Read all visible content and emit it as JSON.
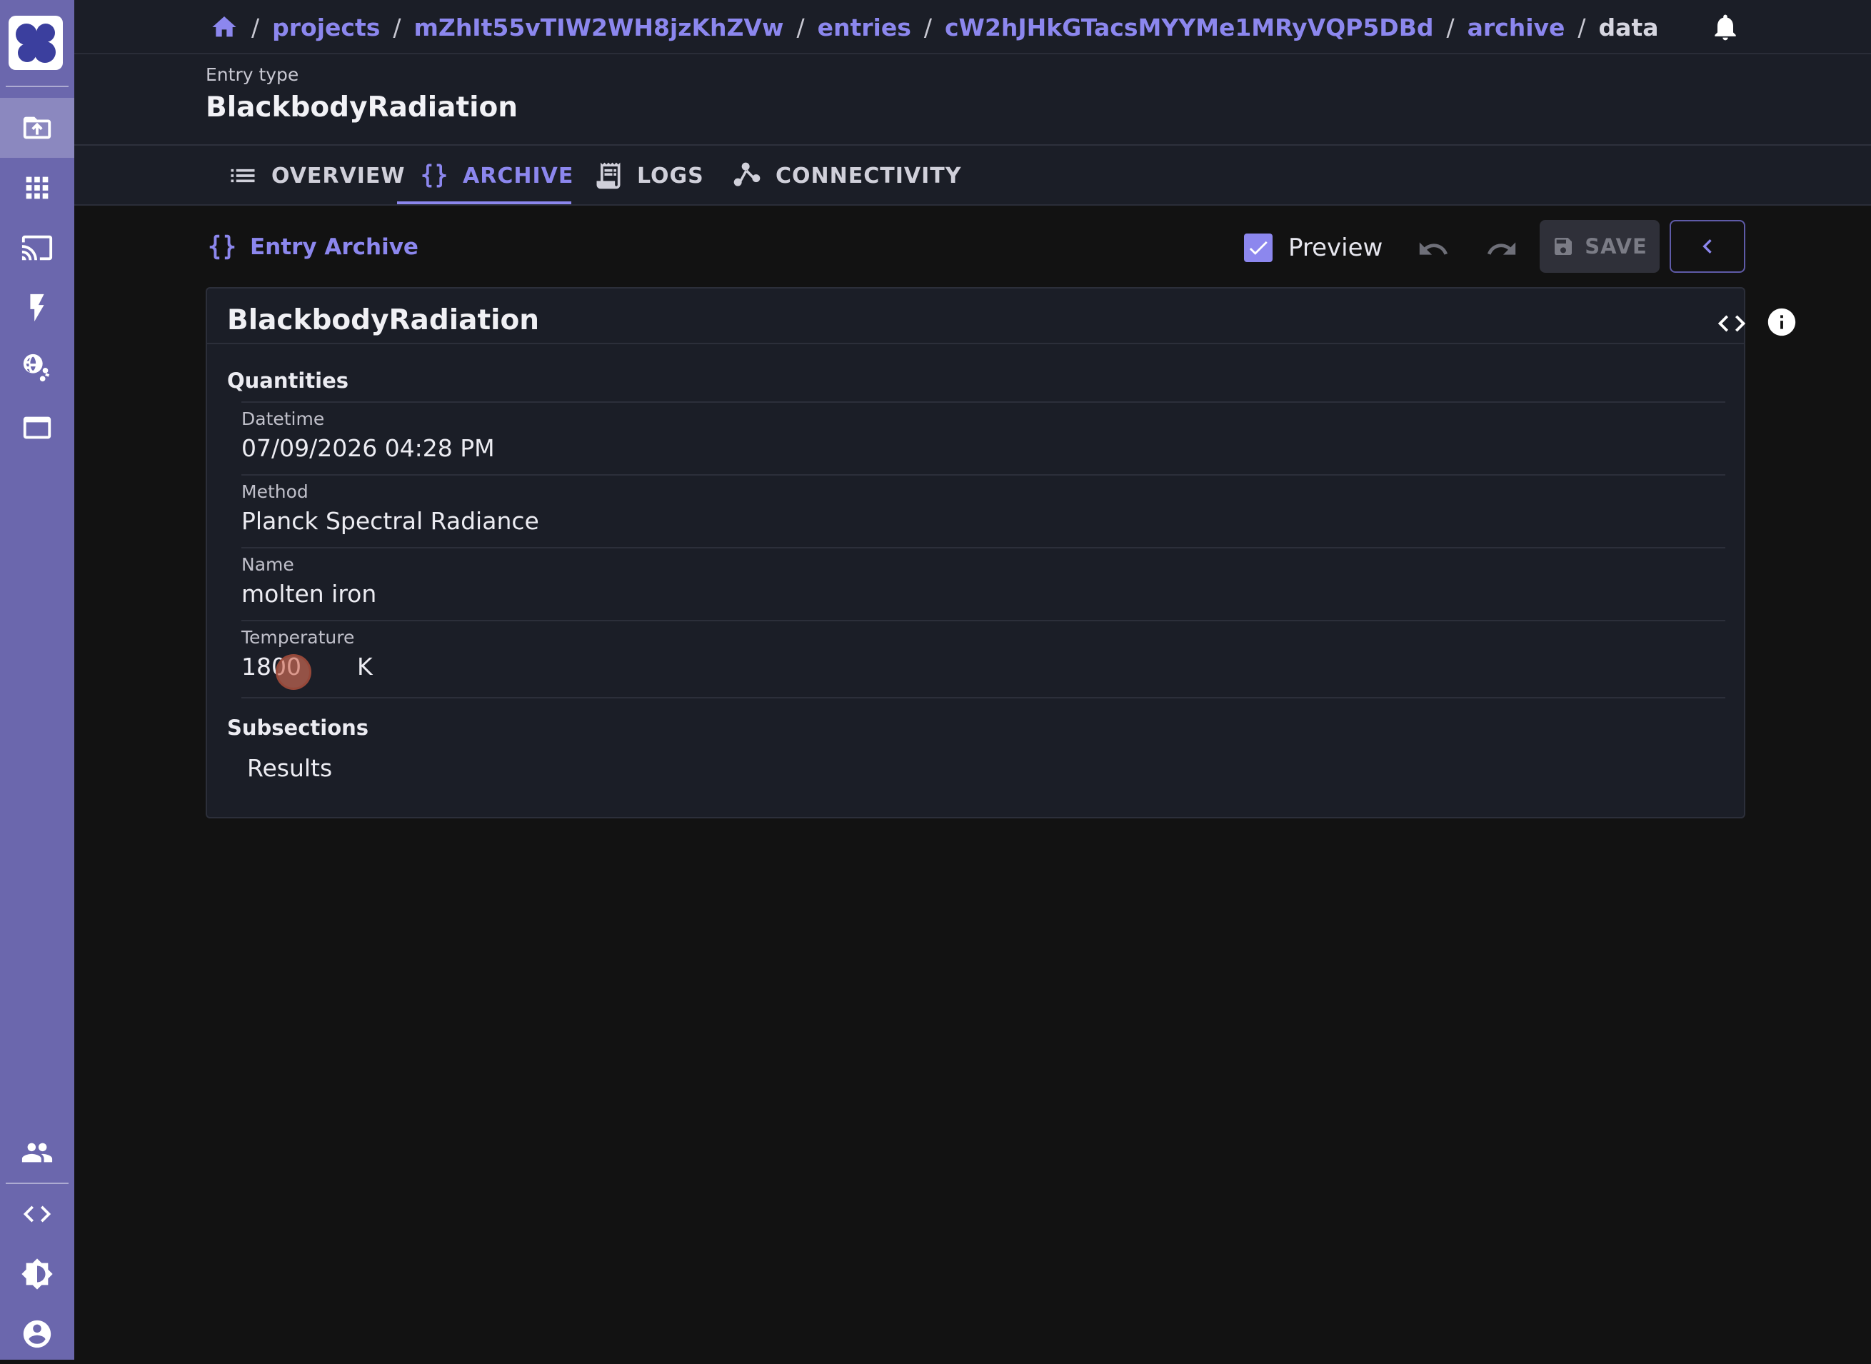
{
  "sidebar": {
    "icons": [
      "logo",
      "upload-icon",
      "apps-icon",
      "cast-icon",
      "lightning-icon",
      "network-globe-icon",
      "window-icon",
      "group-icon",
      "code-icon",
      "theme-icon",
      "account-icon"
    ]
  },
  "breadcrumb": {
    "items": [
      "projects",
      "mZhIt55vTIW2WH8jzKhZVw",
      "entries",
      "cW2hJHkGTacsMYYMe1MRyVQP5DBd",
      "archive"
    ],
    "current": "data"
  },
  "header": {
    "entry_type_label": "Entry type",
    "entry_type_value": "BlackbodyRadiation"
  },
  "tabs": [
    {
      "label": "OVERVIEW",
      "active": false
    },
    {
      "label": "ARCHIVE",
      "active": true
    },
    {
      "label": "LOGS",
      "active": false
    },
    {
      "label": "CONNECTIVITY",
      "active": false
    }
  ],
  "archive": {
    "title": "Entry Archive",
    "preview_label": "Preview",
    "preview_checked": true,
    "save_label": "SAVE"
  },
  "card": {
    "title": "BlackbodyRadiation",
    "quantities_label": "Quantities",
    "fields": [
      {
        "label": "Datetime",
        "value": "07/09/2026 04:28 PM"
      },
      {
        "label": "Method",
        "value": "Planck Spectral Radiance"
      },
      {
        "label": "Name",
        "value": "molten iron"
      },
      {
        "label": "Temperature",
        "value": "1800",
        "unit": "K"
      }
    ],
    "subsections_label": "Subsections",
    "subsections": [
      "Results"
    ]
  },
  "colors": {
    "accent": "#8c87ee",
    "rail": "#6b67ad",
    "panel": "#1b1e27",
    "background": "#121212"
  }
}
